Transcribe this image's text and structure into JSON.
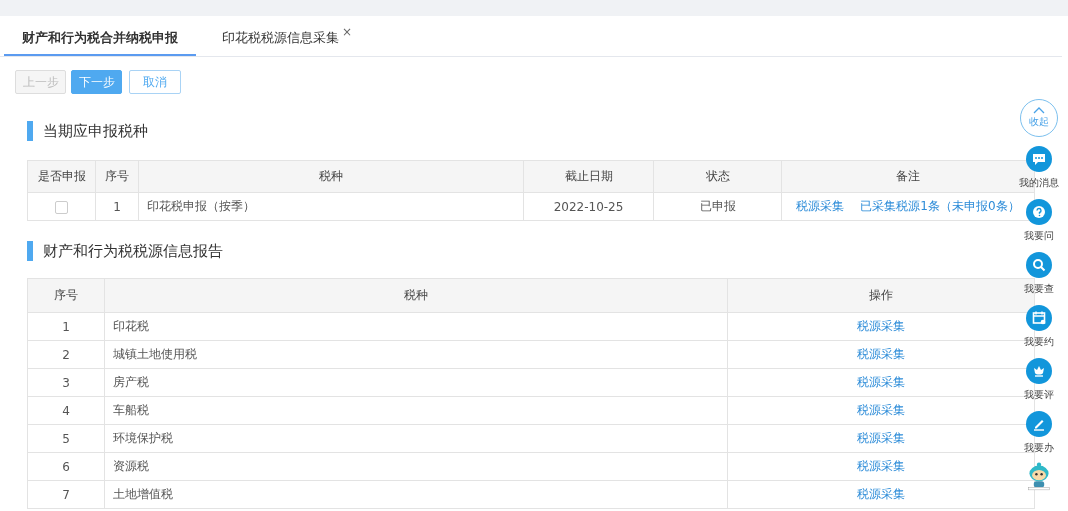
{
  "tabs": [
    {
      "label": "财产和行为税合并纳税申报",
      "selected": true
    },
    {
      "label": "印花税税源信息采集",
      "selected": false,
      "close_glyph": "×"
    }
  ],
  "buttons": [
    {
      "label": "上一步",
      "kind": "disabled"
    },
    {
      "label": "下一步",
      "kind": "primary"
    },
    {
      "label": "取消",
      "kind": "outline"
    }
  ],
  "declare_section": {
    "title": "当期应申报税种",
    "columns": [
      "是否申报",
      "序号",
      "税种",
      "截止日期",
      "状态",
      "备注"
    ],
    "rows": [
      {
        "checked": false,
        "index": "1",
        "tax": "印花税申报（按季）",
        "deadline": "2022-10-25",
        "status": "已申报",
        "links": [
          "税源采集",
          "已采集税源1条（未申报0条）"
        ]
      }
    ]
  },
  "source_section": {
    "title": "财产和行为税税源信息报告",
    "columns": [
      "序号",
      "税种",
      "操作"
    ],
    "rows": [
      {
        "index": "1",
        "tax": "印花税",
        "action": "税源采集"
      },
      {
        "index": "2",
        "tax": "城镇土地使用税",
        "action": "税源采集"
      },
      {
        "index": "3",
        "tax": "房产税",
        "action": "税源采集"
      },
      {
        "index": "4",
        "tax": "车船税",
        "action": "税源采集"
      },
      {
        "index": "5",
        "tax": "环境保护税",
        "action": "税源采集"
      },
      {
        "index": "6",
        "tax": "资源税",
        "action": "税源采集"
      },
      {
        "index": "7",
        "tax": "土地增值税",
        "action": "税源采集"
      }
    ]
  },
  "side_toolbar": {
    "collapse": "收起",
    "items": [
      {
        "kind": "message",
        "label": "我的消息"
      },
      {
        "kind": "question",
        "label": "我要问"
      },
      {
        "kind": "search",
        "label": "我要查"
      },
      {
        "kind": "calendar",
        "label": "我要约"
      },
      {
        "kind": "rate",
        "label": "我要评"
      },
      {
        "kind": "edit",
        "label": "我要办"
      }
    ],
    "assistant": {
      "kind": "robot"
    }
  }
}
